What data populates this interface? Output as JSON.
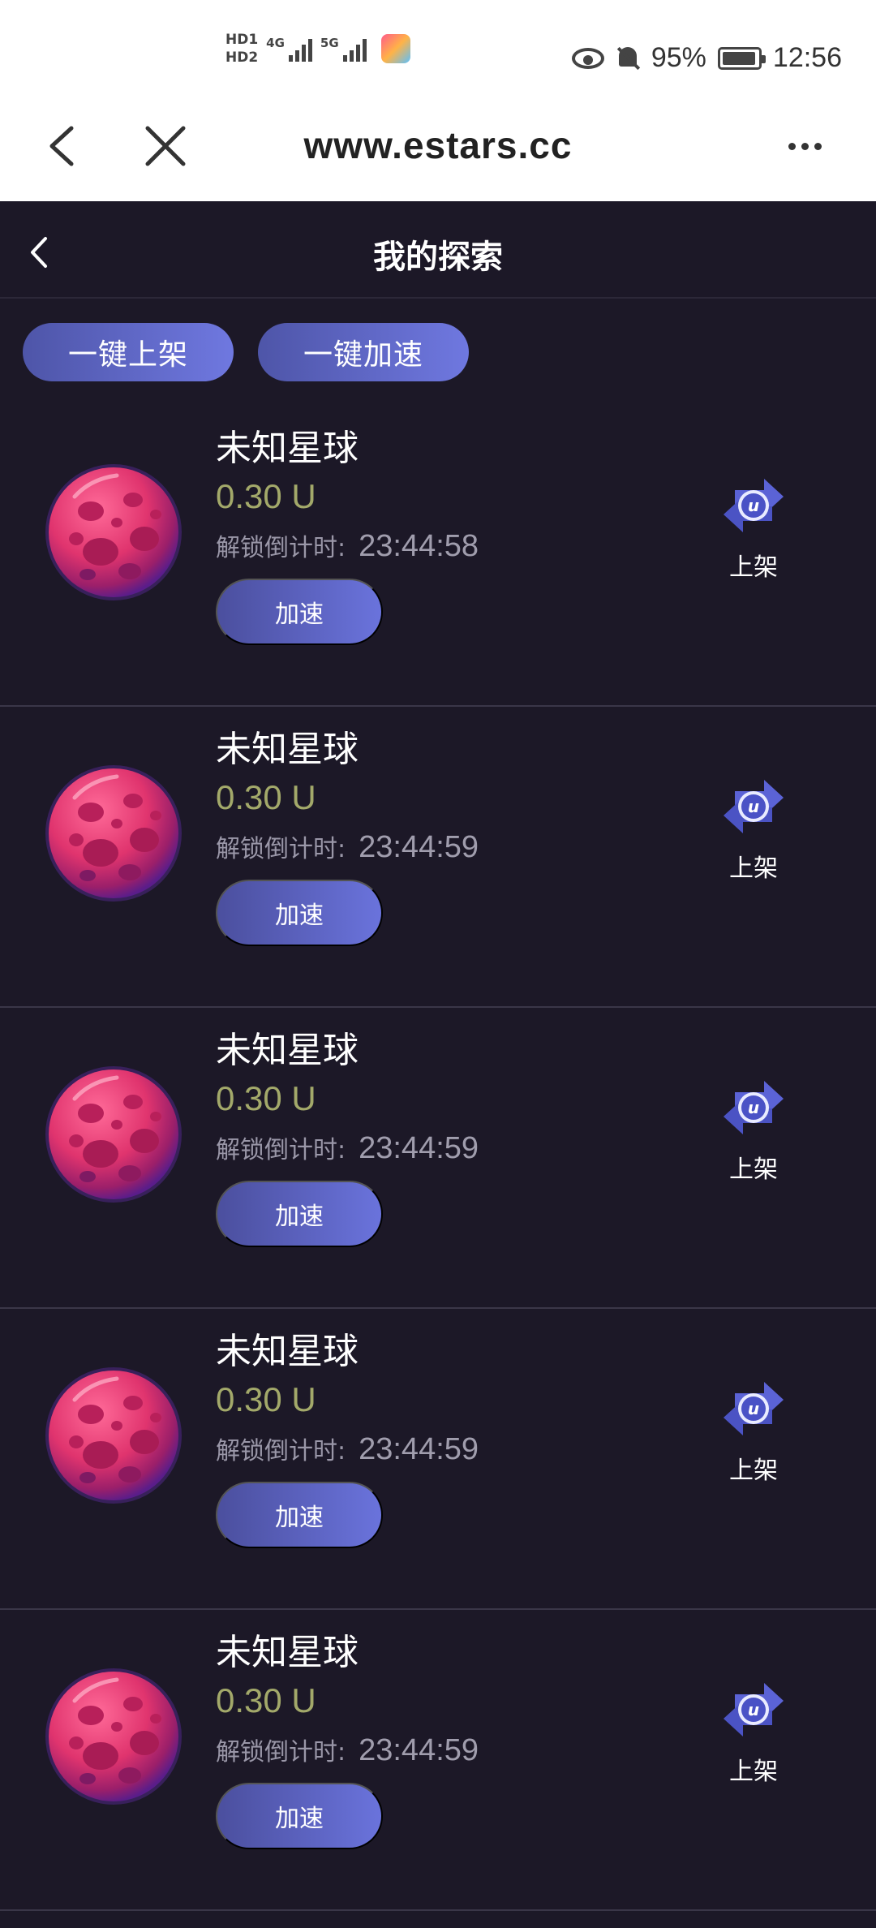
{
  "status_bar": {
    "hd1": "HD1",
    "hd2": "HD2",
    "net1": "4G",
    "net2": "5G",
    "battery_percent": "95%",
    "time": "12:56",
    "icons": [
      "eye-icon",
      "bell-off-icon",
      "battery-icon"
    ]
  },
  "browser": {
    "url": "www.estars.cc"
  },
  "page": {
    "title": "我的探索"
  },
  "actions": {
    "list_all": "一键上架",
    "speed_all": "一键加速"
  },
  "items": [
    {
      "name": "未知星球",
      "price": "0.30 U",
      "countdown_label": "解锁倒计时:",
      "countdown": "23:44:58",
      "speed_label": "加速",
      "shelf_label": "上架"
    },
    {
      "name": "未知星球",
      "price": "0.30 U",
      "countdown_label": "解锁倒计时:",
      "countdown": "23:44:59",
      "speed_label": "加速",
      "shelf_label": "上架"
    },
    {
      "name": "未知星球",
      "price": "0.30 U",
      "countdown_label": "解锁倒计时:",
      "countdown": "23:44:59",
      "speed_label": "加速",
      "shelf_label": "上架"
    },
    {
      "name": "未知星球",
      "price": "0.30 U",
      "countdown_label": "解锁倒计时:",
      "countdown": "23:44:59",
      "speed_label": "加速",
      "shelf_label": "上架"
    },
    {
      "name": "未知星球",
      "price": "0.30 U",
      "countdown_label": "解锁倒计时:",
      "countdown": "23:44:59",
      "speed_label": "加速",
      "shelf_label": "上架"
    }
  ],
  "colors": {
    "background": "#1c1827",
    "price": "#a3a96a",
    "button_start": "#4e55a8",
    "button_end": "#6f78e0",
    "planet": "#e0346e",
    "shelf_icon": "#5b63d6"
  }
}
